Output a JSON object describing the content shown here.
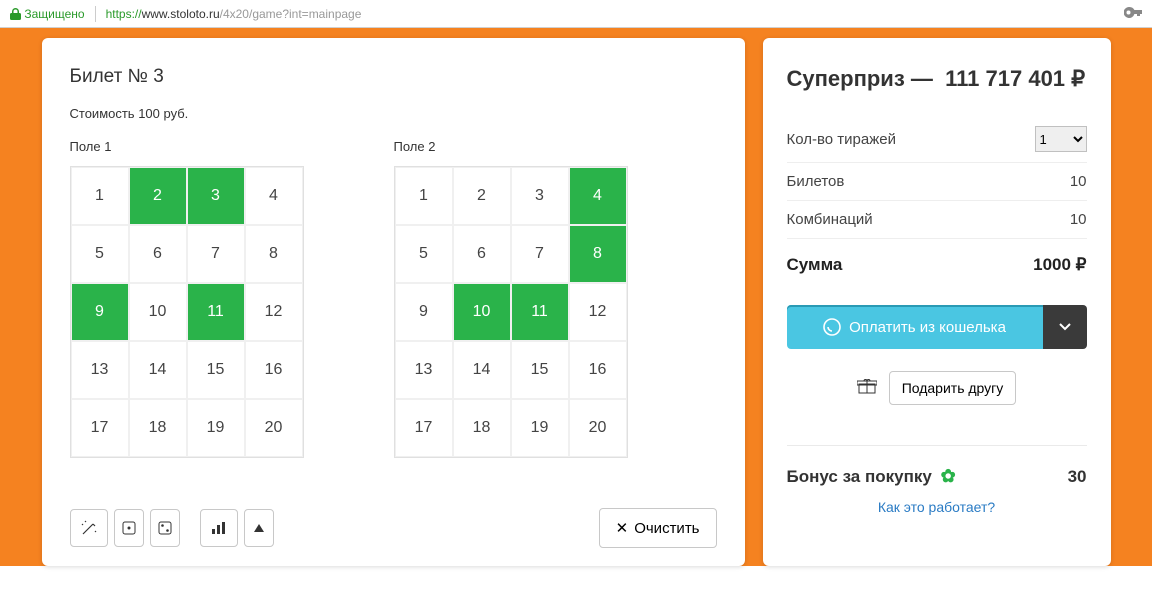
{
  "browser": {
    "secure_label": "Защищено",
    "proto": "https://",
    "host": "www.stoloto.ru",
    "path": "/4x20/game?int=mainpage"
  },
  "ticket": {
    "title": "Билет № 3",
    "cost": "Стоимость 100 руб."
  },
  "fields": {
    "field1": {
      "label": "Поле 1",
      "selected": [
        2,
        3,
        9,
        11
      ]
    },
    "field2": {
      "label": "Поле 2",
      "selected": [
        4,
        8,
        10,
        11
      ]
    },
    "numbers": [
      1,
      2,
      3,
      4,
      5,
      6,
      7,
      8,
      9,
      10,
      11,
      12,
      13,
      14,
      15,
      16,
      17,
      18,
      19,
      20
    ]
  },
  "toolbar": {
    "clear": "Очистить"
  },
  "side": {
    "superprize_label": "Суперприз —",
    "superprize_value": "111 717 401 ₽",
    "draws_label": "Кол-во тиражей",
    "draws_value": "1",
    "tickets_label": "Билетов",
    "tickets_value": "10",
    "combos_label": "Комбинаций",
    "combos_value": "10",
    "total_label": "Сумма",
    "total_value": "1000 ₽",
    "pay_label": "Оплатить из кошелька",
    "gift_label": "Подарить другу",
    "bonus_label": "Бонус за покупку",
    "bonus_value": "30",
    "how_link": "Как это работает?"
  }
}
